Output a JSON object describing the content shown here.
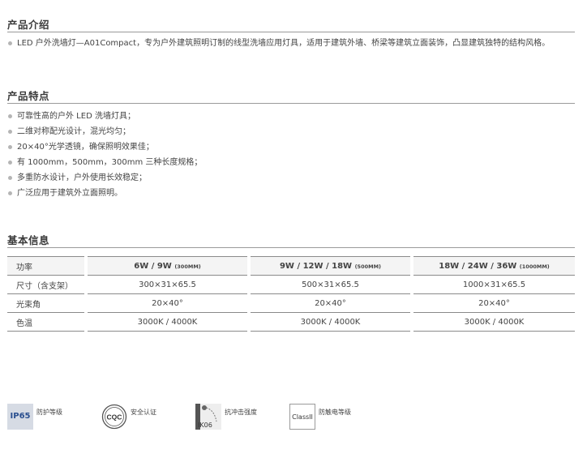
{
  "intro": {
    "title": "产品介绍",
    "items": [
      "LED 户外洗墙灯—A01Compact，专为户外建筑照明订制的线型洗墙应用灯具，适用于建筑外墙、桥梁等建筑立面装饰，凸显建筑独特的结构风格。"
    ]
  },
  "features": {
    "title": "产品特点",
    "items": [
      "可靠性高的户外 LED 洗墙灯具；",
      "二维对称配光设计，混光均匀；",
      "20×40°光学透镜，确保照明效果佳；",
      "有 1000mm，500mm，300mm 三种长度规格；",
      "多重防水设计，户外使用长效稳定；",
      "广泛应用于建筑外立面照明。"
    ]
  },
  "info": {
    "title": "基本信息",
    "header": {
      "label": "功率",
      "cols": [
        {
          "main": "6W / 9W",
          "note": "(300MM)"
        },
        {
          "main": "9W / 12W / 18W",
          "note": "(500MM)"
        },
        {
          "main": "18W / 24W / 36W",
          "note": "(1000MM)"
        }
      ]
    },
    "rows": [
      {
        "label": "尺寸（含支架）",
        "values": [
          "300×31×65.5",
          "500×31×65.5",
          "1000×31×65.5"
        ]
      },
      {
        "label": "光束角",
        "values": [
          "20×40°",
          "20×40°",
          "20×40°"
        ]
      },
      {
        "label": "色温",
        "values": [
          "3000K / 4000K",
          "3000K / 4000K",
          "3000K / 4000K"
        ]
      }
    ]
  },
  "badges": [
    {
      "icon": "ip65-icon",
      "icon_text": "IP65",
      "caption": "防护等级"
    },
    {
      "icon": "ccc-certification-icon",
      "icon_text": "CQC",
      "caption": "安全认证"
    },
    {
      "icon": "impact-ik06-icon",
      "icon_text": "IK06",
      "caption": "抗冲击强度"
    },
    {
      "icon": "class-ii-icon",
      "icon_text": "ClassII",
      "caption": "防触电等级"
    }
  ]
}
